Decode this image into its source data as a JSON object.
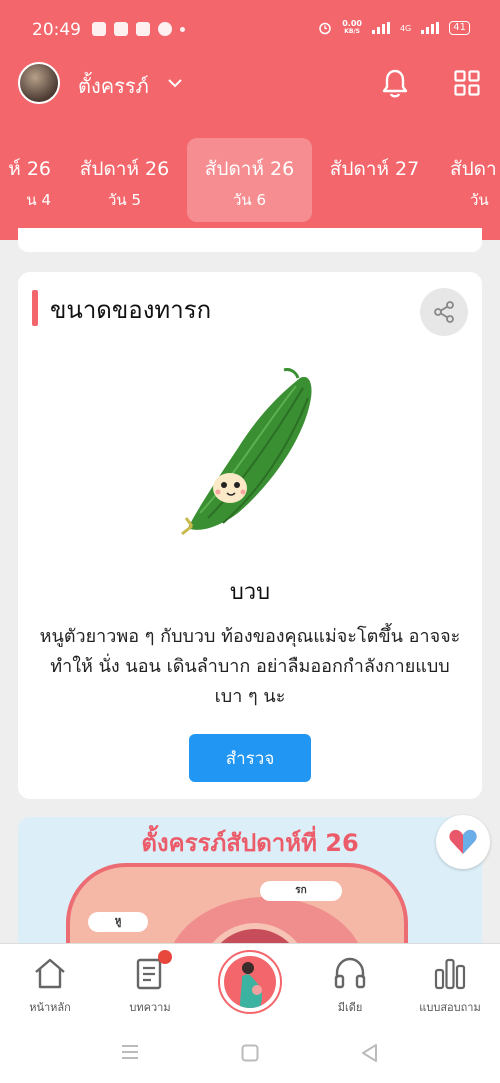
{
  "status": {
    "time": "20:49",
    "net_speed_value": "0.00",
    "net_speed_unit": "KB/S",
    "network_type": "4G",
    "battery": "41"
  },
  "profile": {
    "name": "ตั้งครรภ์"
  },
  "week_tabs": [
    {
      "week": "ห์ 26",
      "day": "น 4"
    },
    {
      "week": "สัปดาห์ 26",
      "day": "วัน 5"
    },
    {
      "week": "สัปดาห์ 26",
      "day": "วัน 6"
    },
    {
      "week": "สัปดาห์ 27",
      "day": ""
    },
    {
      "week": "สัปดา",
      "day": "วัน"
    }
  ],
  "baby_size": {
    "title": "ขนาดของทารก",
    "fruit_name": "บวบ",
    "description": "หนูตัวยาวพอ ๆ กับบวบ ท้องของคุณแม่จะโตขึ้น อาจจะทำให้ นั่ง นอน เดินลำบาก อย่าลืมออกกำลังกายแบบเบา ๆ นะ",
    "explore_label": "สำรวจ"
  },
  "pregnancy_card": {
    "title": "ตั้งครรภ์สัปดาห์ที่ 26",
    "label_placenta": "รก",
    "label_ear": "หู"
  },
  "bottom_nav": {
    "home": "หน้าหลัก",
    "articles": "บทความ",
    "media": "มีเดีย",
    "survey": "แบบสอบถาม"
  },
  "colors": {
    "primary": "#f3676c",
    "button": "#2196f3",
    "fruit": "#3a8f32"
  },
  "icons": [
    "bell-icon",
    "grid-icon",
    "share-icon",
    "home-icon",
    "document-icon",
    "headphones-icon",
    "chart-icon",
    "heart-icon"
  ]
}
